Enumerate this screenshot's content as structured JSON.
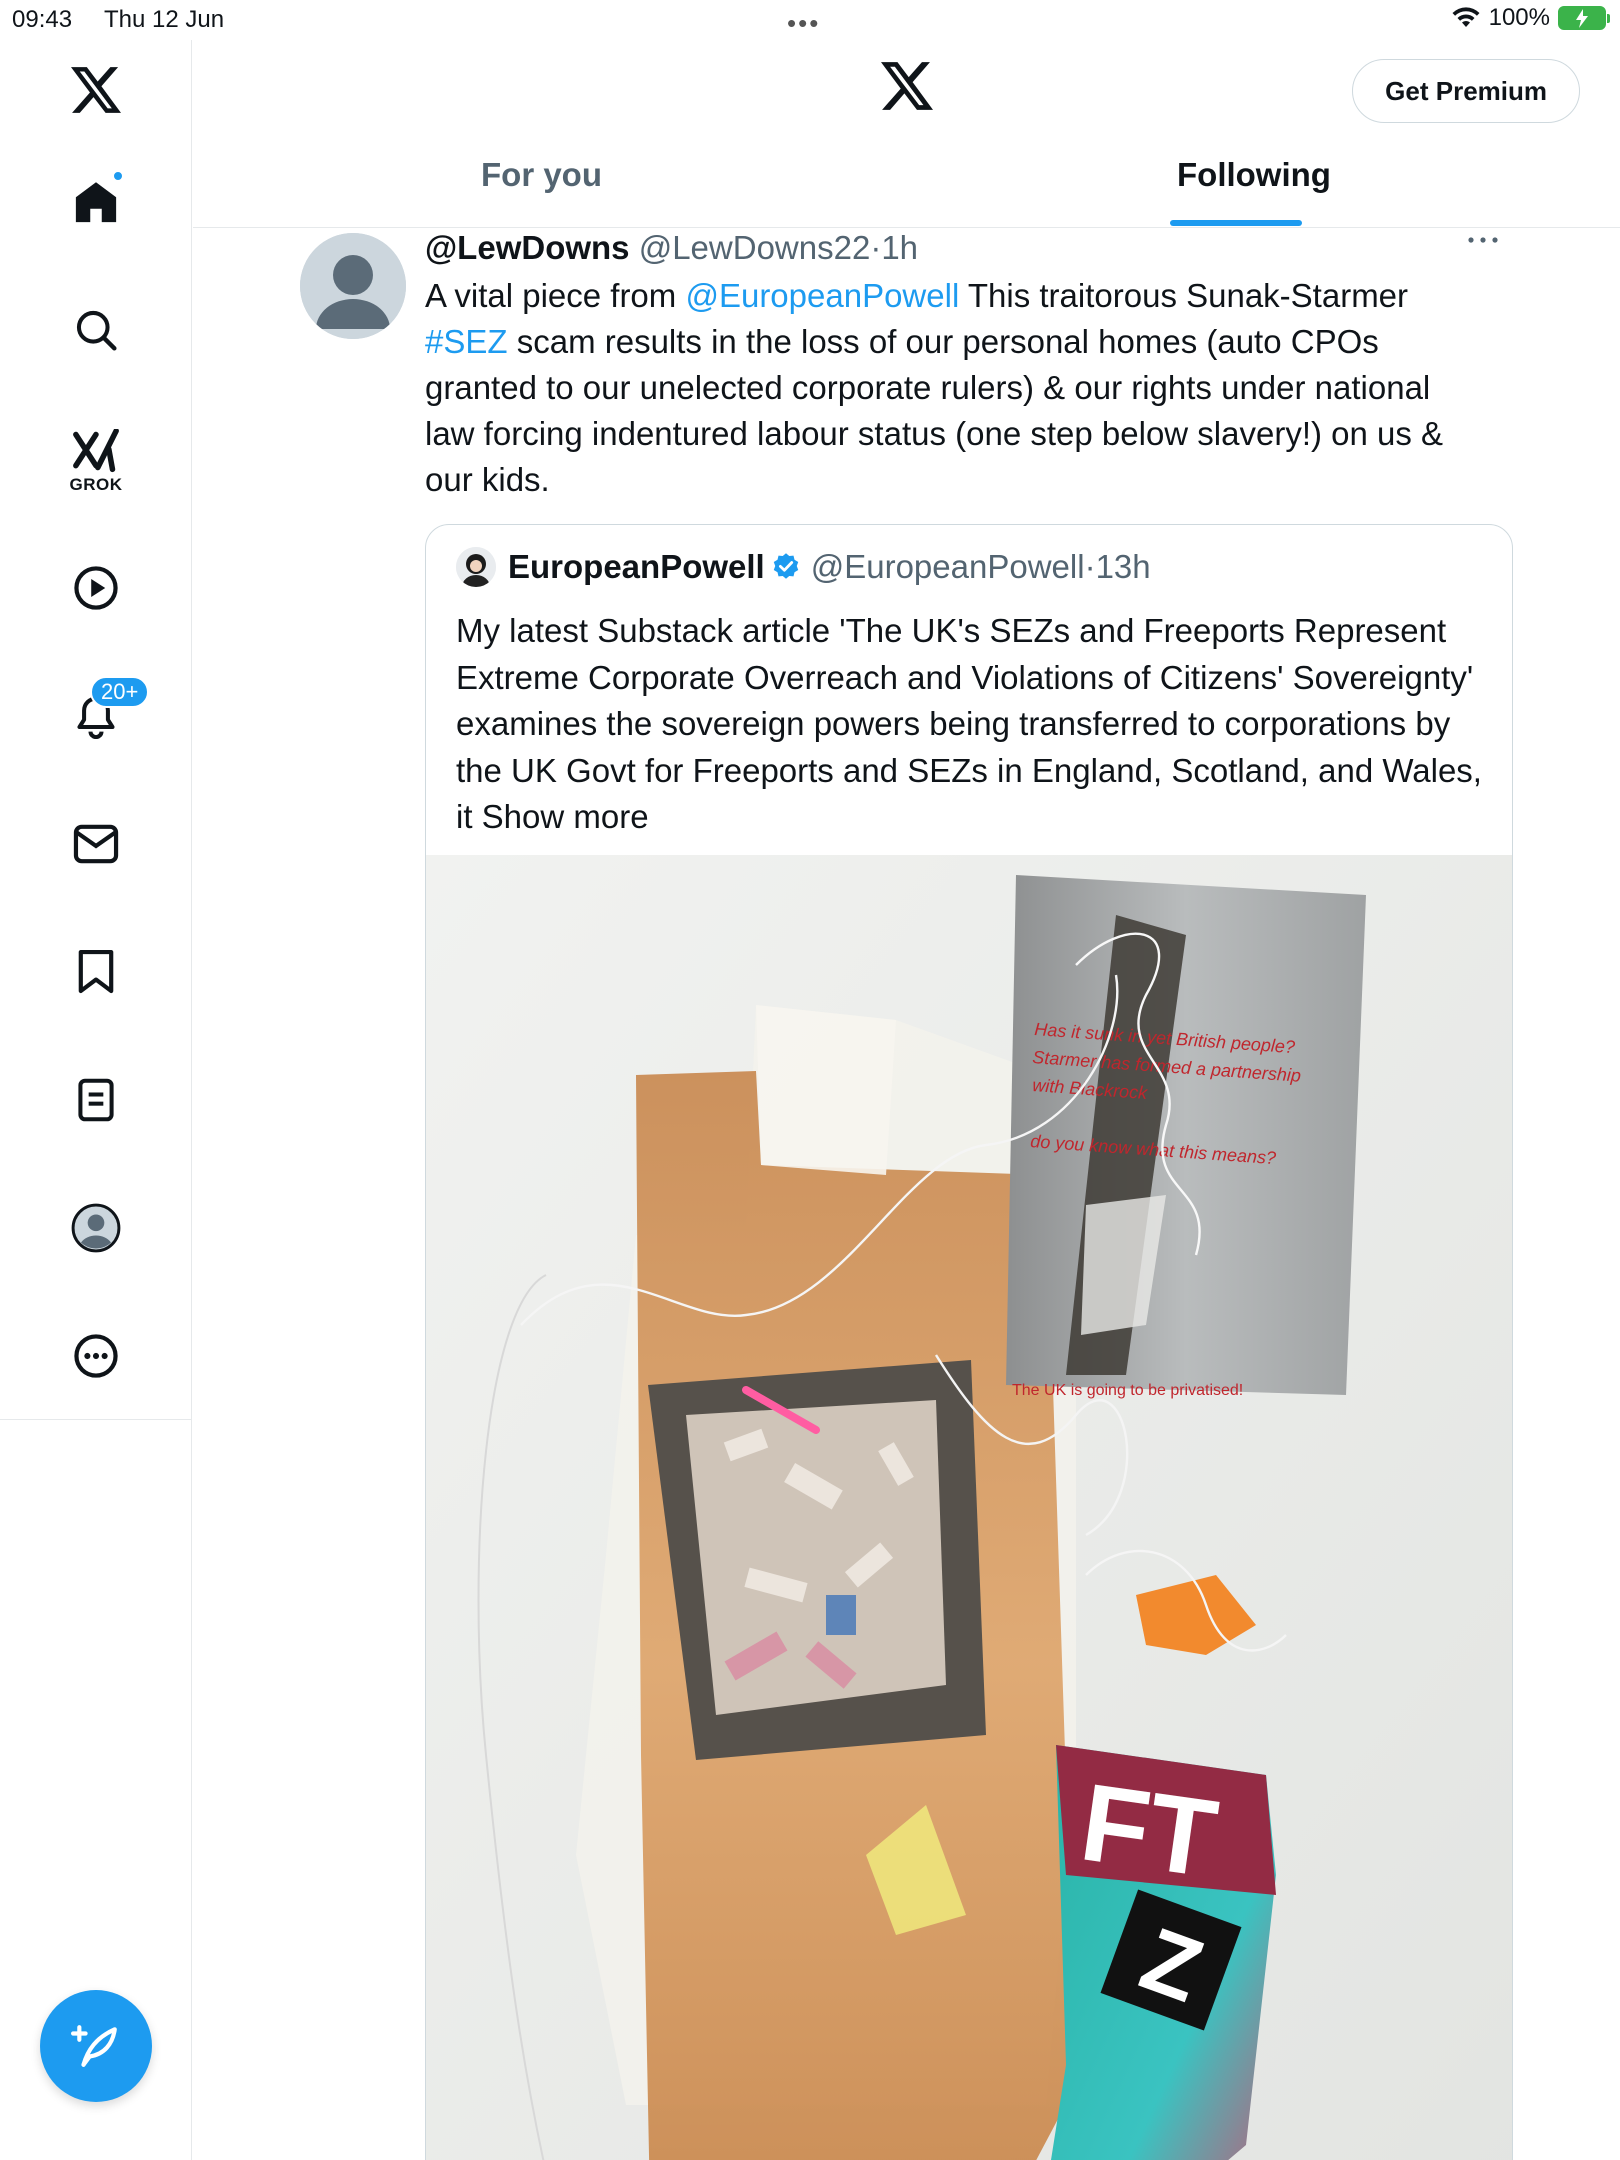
{
  "status_bar": {
    "time": "09:43",
    "date": "Thu 12 Jun",
    "battery": "100%"
  },
  "sidebar": {
    "grok_label": "GROK",
    "notifications_badge": "20+",
    "items": [
      "home-icon",
      "search-icon",
      "grok-icon",
      "video-icon",
      "bell-icon",
      "mail-icon",
      "bookmark-icon",
      "lists-icon",
      "profile-icon",
      "more-icon"
    ]
  },
  "header": {
    "premium_label": "Get Premium",
    "tabs": [
      {
        "label": "For you",
        "selected": false
      },
      {
        "label": "Following",
        "selected": true
      }
    ]
  },
  "post": {
    "name": "@LewDowns",
    "handle": "@LewDowns22",
    "time": "1h",
    "text_1": "A vital piece from ",
    "mention": "@EuropeanPowell",
    "text_2": " This traitorous Sunak-Starmer ",
    "hashtag": "#SEZ",
    "text_3": " scam results in the loss of our personal homes (auto CPOs granted to our unelected corporate rulers) & our rights under national law forcing indentured labour status (one step below slavery!) on us & our kids."
  },
  "quote": {
    "name": "EuropeanPowell",
    "handle": "@EuropeanPowell",
    "time": "13h",
    "text": "My latest Substack article 'The UK's SEZs and Freeports Represent Extreme Corporate Overreach and Violations of Citizens' Sovereignty' examines the sovereign powers being transferred to corporations by the UK Govt for Freeports and SEZs in England, Scotland, and Wales, it ",
    "show_more": "Show more",
    "media": {
      "poster_line_1": "Has it sunk in yet British people?",
      "poster_line_2": "Starmer has formed a partnership",
      "poster_line_3": "with Blackrock",
      "poster_line_4": "do you know what this means?",
      "poster_bottom": "The UK is going to be privatised!",
      "sticker_top": "FT",
      "sticker_bottom": "Z"
    }
  },
  "colors": {
    "accent": "#1d9bf0",
    "text": "#0f1419",
    "secondary": "#536471",
    "border": "#cfd9de"
  }
}
